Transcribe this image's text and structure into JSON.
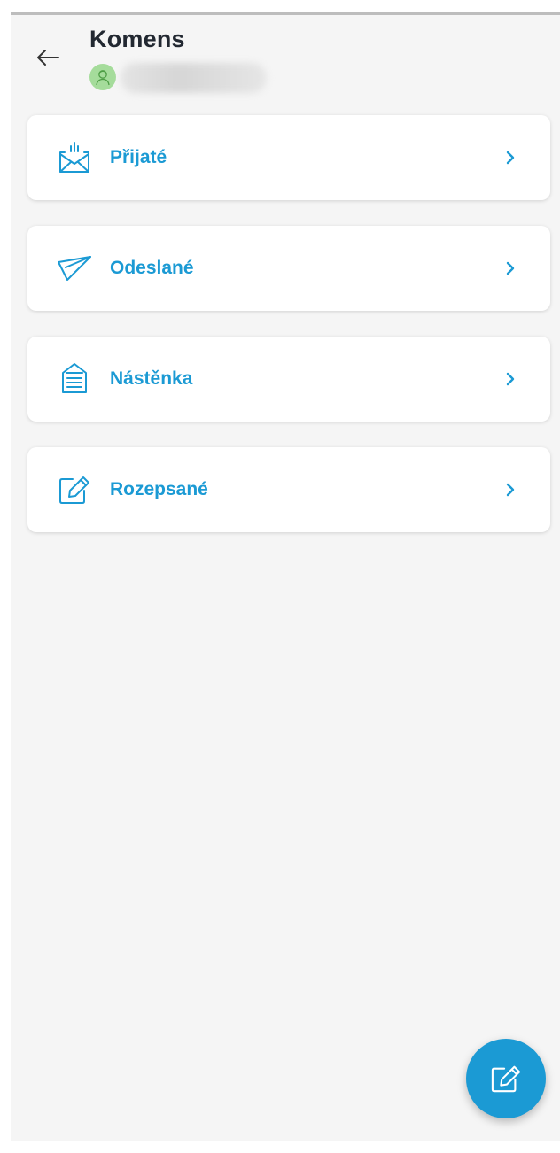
{
  "header": {
    "title": "Komens",
    "user_name": "",
    "back_icon": "arrow-left-icon",
    "avatar_icon": "user-avatar-icon"
  },
  "menu": {
    "items": [
      {
        "label": "Přijaté",
        "icon": "inbox-envelope-icon",
        "chevron": "chevron-right-icon"
      },
      {
        "label": "Odeslané",
        "icon": "paper-plane-icon",
        "chevron": "chevron-right-icon"
      },
      {
        "label": "Nástěnka",
        "icon": "noticeboard-icon",
        "chevron": "chevron-right-icon"
      },
      {
        "label": "Rozepsané",
        "icon": "edit-draft-icon",
        "chevron": "chevron-right-icon"
      }
    ]
  },
  "fab": {
    "icon": "compose-icon"
  },
  "colors": {
    "accent": "#1b9ad4",
    "background": "#f5f5f5",
    "card": "#ffffff",
    "title": "#222831",
    "avatar": "#a5dc9b"
  }
}
